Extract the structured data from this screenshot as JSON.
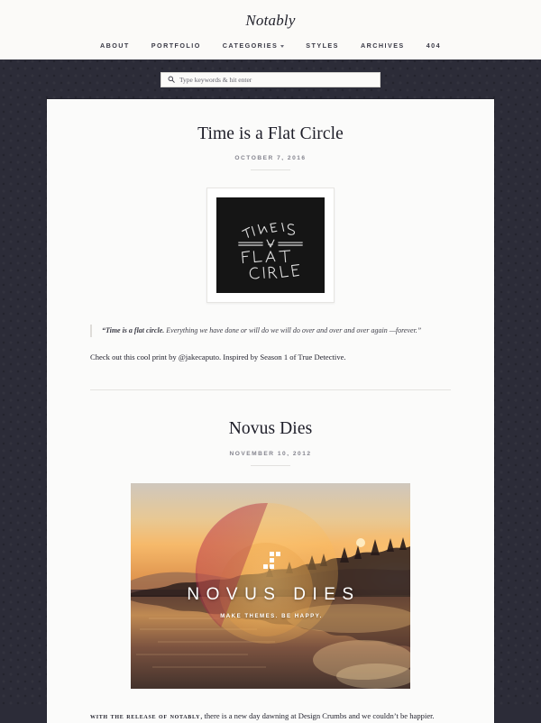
{
  "site": {
    "title": "Notably",
    "nav": [
      {
        "label": "ABOUT",
        "has_dropdown": false
      },
      {
        "label": "PORTFOLIO",
        "has_dropdown": false
      },
      {
        "label": "CATEGORIES",
        "has_dropdown": true
      },
      {
        "label": "STYLES",
        "has_dropdown": false
      },
      {
        "label": "ARCHIVES",
        "has_dropdown": false
      },
      {
        "label": "404",
        "has_dropdown": false
      }
    ]
  },
  "search": {
    "icon": "search-icon",
    "placeholder": "Type keywords & hit enter",
    "value": ""
  },
  "posts": [
    {
      "title": "Time is a Flat Circle",
      "date": "OCTOBER 7, 2016",
      "featured_image": {
        "type": "framed-print",
        "alt_text": "TIME IS A FLAT CIRCLE",
        "lettering_lines": [
          "TIME IS",
          "A",
          "FLAT",
          "CIRCLE"
        ],
        "frame_color": "#ffffff",
        "print_background": "#151515"
      },
      "quote_lead": "“Time is a flat circle.",
      "quote_rest": " Everything we have done or will do we will do over and over and over again —forever.”",
      "body": "Check out this cool print by @jakecaputo. Inspired by Season 1 of True Detective."
    },
    {
      "title": "Novus Dies",
      "date": "NOVEMBER 10, 2012",
      "featured_image": {
        "type": "photo",
        "alt_text": "Sunset over a forest lake",
        "overlay_title": "NOVUS DIES",
        "overlay_subtitle": "MAKE THEMES. BE HAPPY.",
        "logo": "crumbs-logo"
      },
      "body_lead": "WITH THE RELEASE OF NOTABLY",
      "body_rest": ", there is a new day dawning at Design Crumbs and we couldn’t be happier."
    }
  ],
  "colors": {
    "page_background": "#2c2c38",
    "card_background": "#fbfbfa",
    "header_background": "#fbfaf8",
    "text_primary": "#1d1d28",
    "text_muted": "#84848e",
    "divider": "#e4e3e0"
  }
}
